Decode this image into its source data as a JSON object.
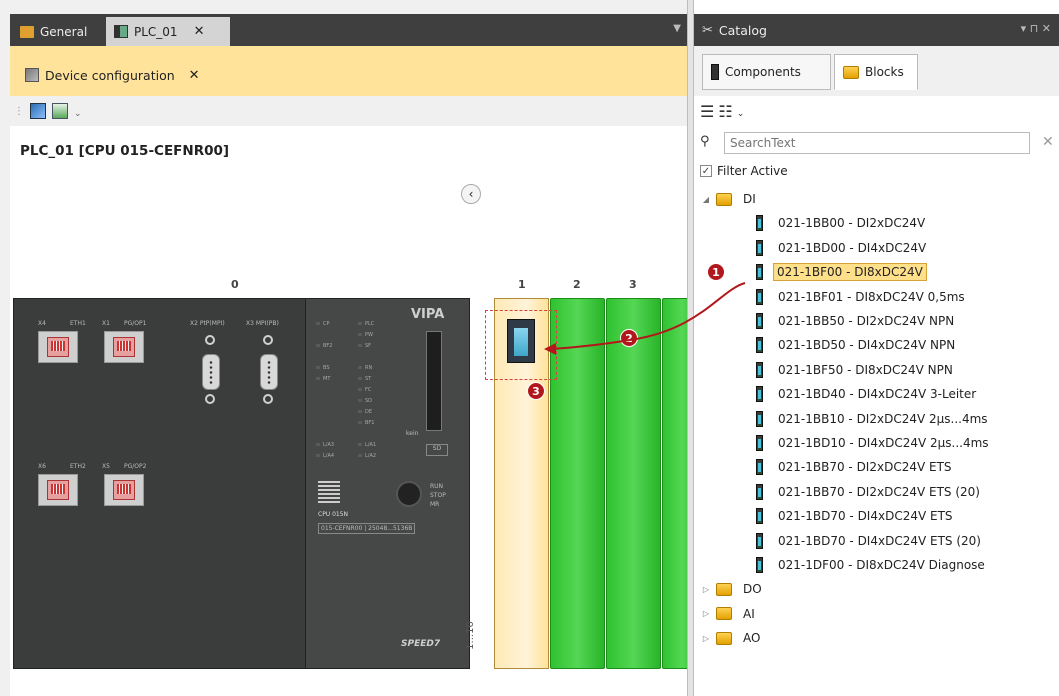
{
  "tabs": {
    "general": "General",
    "plc": "PLC_01",
    "close": "✕"
  },
  "subtab": {
    "label": "Device configuration",
    "close": "✕"
  },
  "config": {
    "title": "PLC_01 [CPU 015-CEFNR00]",
    "collapse": "‹"
  },
  "slots": {
    "s0": "0",
    "s1": "1",
    "s2": "2",
    "s3": "3",
    "range": "1...10"
  },
  "cpu": {
    "brand": "VIPA",
    "speed": "SPEED7",
    "name": "CPU 015N",
    "order": "015-CEFNR00 | 25048...5136B",
    "sd": "SD",
    "port_labels": [
      "X4",
      "ETH1",
      "X1",
      "PG/OP1",
      "X2 PtP(MPI)",
      "X3 MPI(PB)",
      "X6",
      "ETH2",
      "X5",
      "PG/OP2"
    ],
    "leds": [
      "CP",
      "PLC",
      "PW",
      "BF2",
      "SF",
      "BS",
      "RN",
      "MT",
      "ST",
      "FC",
      "SD",
      "DE",
      "BF1",
      "L/A3",
      "L/A1",
      "L/A4",
      "L/A2",
      "RUN",
      "STOP",
      "MR"
    ],
    "knob_label": "kein"
  },
  "steps": [
    "1",
    "2",
    "3"
  ],
  "catalog": {
    "title": "Catalog",
    "pin": "▾ ⊓ ✕",
    "tab_components": "Components",
    "tab_blocks": "Blocks",
    "search_placeholder": "SearchText",
    "search_clear": "✕",
    "filter_label": "Filter Active",
    "filter_checked": "✓",
    "tree": [
      {
        "label": "DI",
        "kind": "folder",
        "expanded": true
      },
      {
        "label": "021-1BB00 - DI2xDC24V",
        "kind": "module"
      },
      {
        "label": "021-1BD00 - DI4xDC24V",
        "kind": "module"
      },
      {
        "label": "021-1BF00 - DI8xDC24V",
        "kind": "module",
        "selected": true
      },
      {
        "label": "021-1BF01 - DI8xDC24V 0,5ms",
        "kind": "module"
      },
      {
        "label": "021-1BB50 - DI2xDC24V NPN",
        "kind": "module"
      },
      {
        "label": "021-1BD50 - DI4xDC24V NPN",
        "kind": "module"
      },
      {
        "label": "021-1BF50 - DI8xDC24V NPN",
        "kind": "module"
      },
      {
        "label": "021-1BD40 - DI4xDC24V 3-Leiter",
        "kind": "module"
      },
      {
        "label": "021-1BB10 - DI2xDC24V 2µs...4ms",
        "kind": "module"
      },
      {
        "label": "021-1BD10 - DI4xDC24V 2µs...4ms",
        "kind": "module"
      },
      {
        "label": "021-1BB70 - DI2xDC24V ETS",
        "kind": "module"
      },
      {
        "label": "021-1BB70 - DI2xDC24V ETS (20)",
        "kind": "module"
      },
      {
        "label": "021-1BD70 - DI4xDC24V ETS",
        "kind": "module"
      },
      {
        "label": "021-1BD70 - DI4xDC24V ETS (20)",
        "kind": "module"
      },
      {
        "label": "021-1DF00 - DI8xDC24V Diagnose",
        "kind": "module"
      },
      {
        "label": "DO",
        "kind": "folder"
      },
      {
        "label": "AI",
        "kind": "folder"
      },
      {
        "label": "AO",
        "kind": "folder"
      }
    ]
  },
  "colors": {
    "accent": "#ffe39a",
    "tabbar": "#3f3f3f",
    "slot_green": "#2fc22f",
    "step_red": "#b2181b"
  }
}
